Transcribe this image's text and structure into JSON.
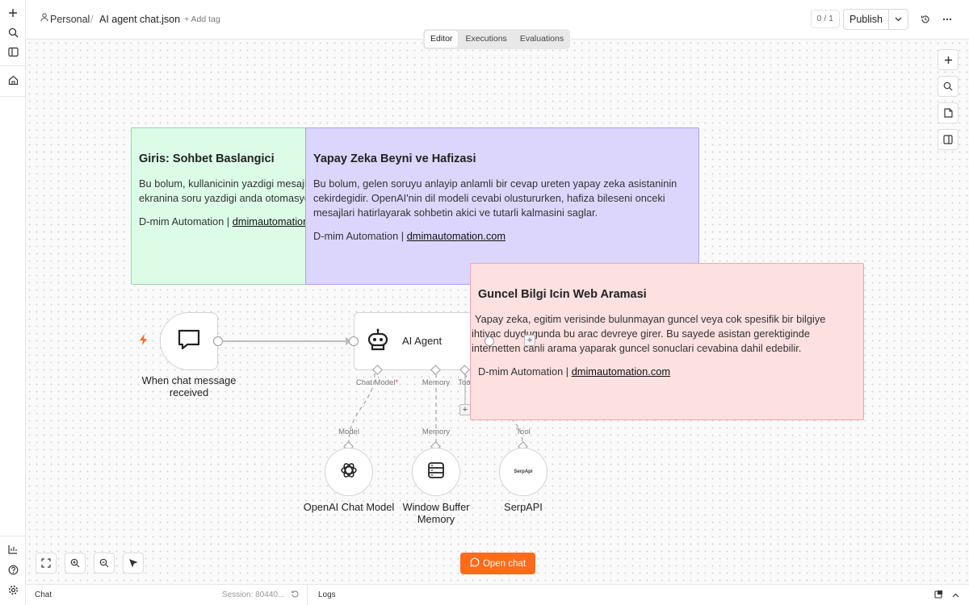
{
  "header": {
    "breadcrumb_project": "Personal",
    "breadcrumb_sep": "/",
    "workflow_name": "AI agent chat.json",
    "add_tag": "+ Add tag",
    "counter": "0 / 1",
    "publish_label": "Publish"
  },
  "tabs": [
    {
      "label": "Editor",
      "active": true
    },
    {
      "label": "Executions",
      "active": false
    },
    {
      "label": "Evaluations",
      "active": false
    }
  ],
  "stickies": [
    {
      "title": "Giris: Sohbet Baslangici",
      "lines": [
        "Bu bolum, kullanicinin yazdigi mesajin",
        "ekranina soru yazdigi anda otomasyon"
      ],
      "sig_prefix": "D-mim Automation | ",
      "sig_link": "dmimautomation.com"
    },
    {
      "title": "Yapay Zeka Beyni ve Hafizasi",
      "lines": [
        "Bu bolum, gelen soruyu anlayip anlamli bir cevap ureten yapay zeka asistaninin",
        "cekirdegidir. OpenAI'nin dil modeli cevabi olustururken, hafiza bileseni onceki",
        "mesajlari hatirlayarak sohbetin akici ve tutarli kalmasini saglar."
      ],
      "sig_prefix": "D-mim Automation | ",
      "sig_link": "dmimautomation.com"
    },
    {
      "title": "Guncel Bilgi Icin Web Aramasi",
      "lines": [
        "Yapay zeka, egitim verisinde bulunmayan guncel veya cok spesifik bir bilgiye",
        "ihtiyac duydugunda bu arac devreye girer. Bu sayede asistan gerektiginde",
        "internetten canli arama yaparak guncel sonuclari cevabina dahil edebilir."
      ],
      "sig_prefix": "D-mim Automation | ",
      "sig_link": "dmimautomation.com"
    }
  ],
  "nodes": {
    "trigger_label_1": "When chat message",
    "trigger_label_2": "received",
    "agent_label": "AI Agent",
    "openai_label": "OpenAI Chat Model",
    "memory_label_1": "Window Buffer",
    "memory_label_2": "Memory",
    "serp_label": "SerpAPI",
    "serp_logo": "SerpApi"
  },
  "ports": {
    "chat_model": "Chat Model",
    "required_mark": "*",
    "memory": "Memory",
    "tool": "Tool",
    "model": "Model",
    "memory_in": "Memory",
    "tool_in": "Tool"
  },
  "open_chat_label": "Open chat",
  "bottom": {
    "chat_label": "Chat",
    "session_label": "Session: 80440...",
    "logs_label": "Logs"
  },
  "colors": {
    "accent": "#ff6b1a",
    "sticky_green": "#dcfce7",
    "sticky_purple": "#dcd6fd",
    "sticky_red": "#fde0e0"
  }
}
